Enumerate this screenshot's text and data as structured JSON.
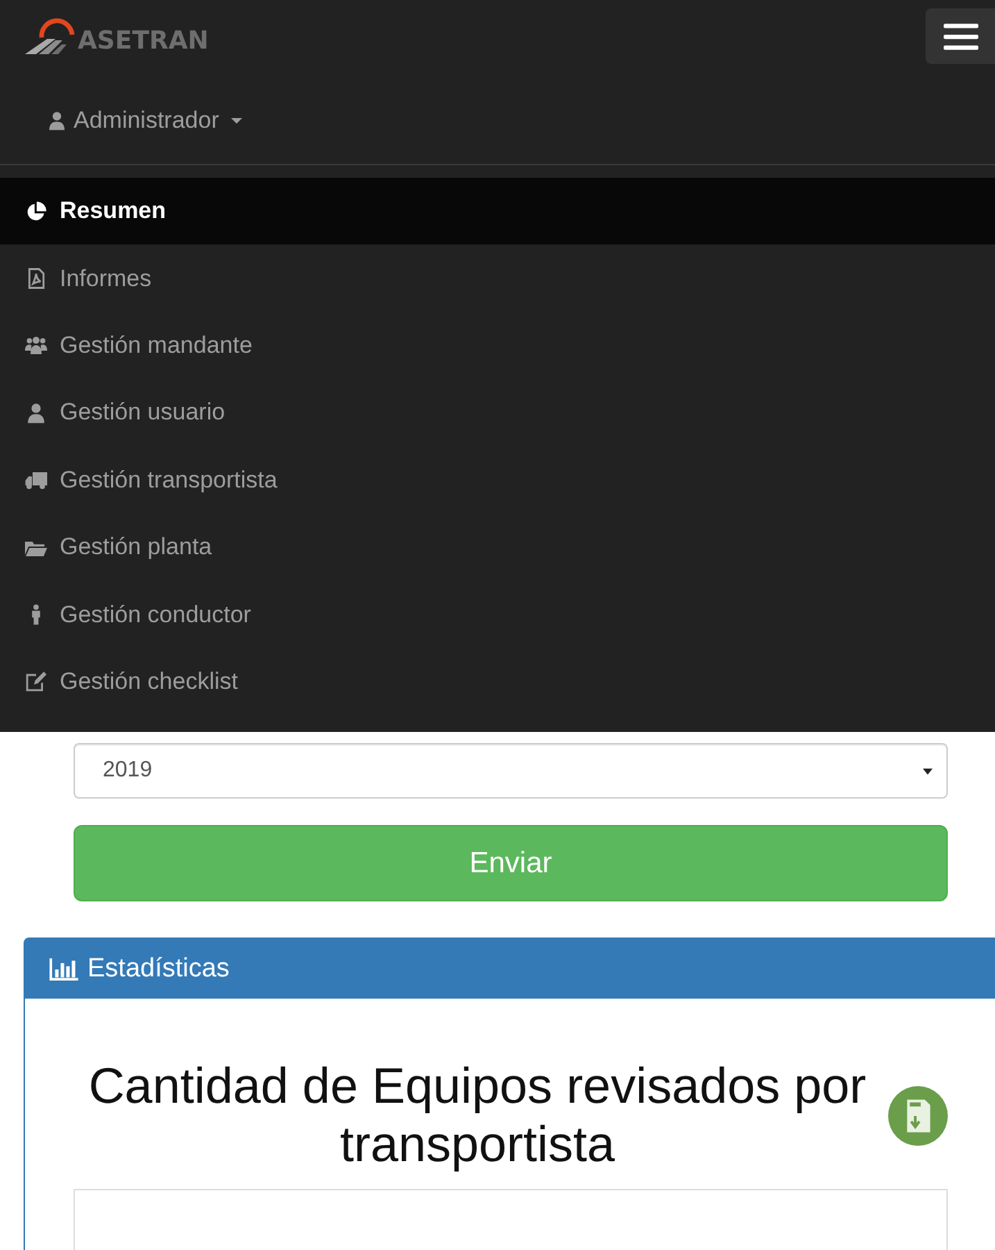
{
  "navbar": {
    "logo_text": "ASETRAN",
    "user_menu": {
      "label": "Administrador"
    }
  },
  "menu": {
    "items": [
      {
        "label": "Resumen",
        "selected": true
      },
      {
        "label": "Informes",
        "selected": false
      },
      {
        "label": "Gestión mandante",
        "selected": false
      },
      {
        "label": "Gestión usuario",
        "selected": false
      },
      {
        "label": "Gestión transportista",
        "selected": false
      },
      {
        "label": "Gestión planta",
        "selected": false
      },
      {
        "label": "Gestión conductor",
        "selected": false
      },
      {
        "label": "Gestión checklist",
        "selected": false
      }
    ]
  },
  "form": {
    "year_select": {
      "value": "2019"
    },
    "submit_button": "Enviar"
  },
  "panel": {
    "title": "Estadísticas",
    "chart_title": "Cantidad de Equipos revisados por transportista"
  }
}
